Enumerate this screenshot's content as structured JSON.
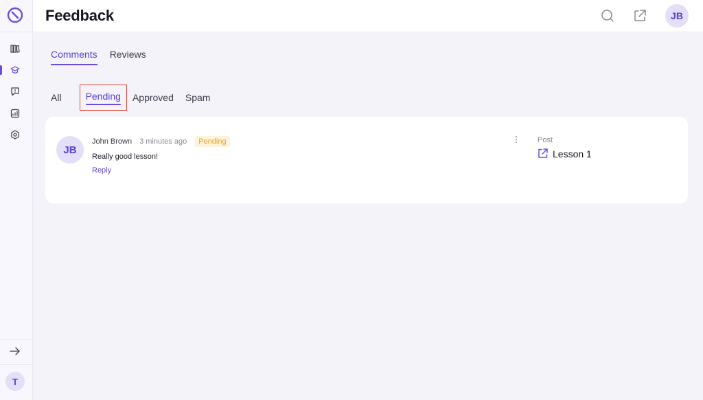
{
  "header": {
    "title": "Feedback",
    "user_initials": "JB"
  },
  "sidebar": {
    "items": [
      {
        "icon": "library-icon"
      },
      {
        "icon": "graduation-cap-icon",
        "active": true
      },
      {
        "icon": "comment-alert-icon"
      },
      {
        "icon": "analytics-icon"
      },
      {
        "icon": "settings-icon"
      }
    ],
    "expand_icon": "arrow-right-icon",
    "workspace_initial": "T"
  },
  "tabs": {
    "top": [
      {
        "label": "Comments",
        "active": true
      },
      {
        "label": "Reviews",
        "active": false
      }
    ],
    "filter": [
      {
        "label": "All",
        "active": false
      },
      {
        "label": "Pending",
        "active": true
      },
      {
        "label": "Approved",
        "active": false
      },
      {
        "label": "Spam",
        "active": false
      }
    ]
  },
  "comments": [
    {
      "initials": "JB",
      "author": "John Brown",
      "time": "3 minutes ago",
      "status": "Pending",
      "text": "Really good lesson!",
      "reply_label": "Reply",
      "post_label": "Post",
      "post_title": "Lesson 1"
    }
  ],
  "colors": {
    "accent": "#6c4ce0",
    "pending_badge": "#e0a42a",
    "highlight_box": "#e0483a"
  }
}
